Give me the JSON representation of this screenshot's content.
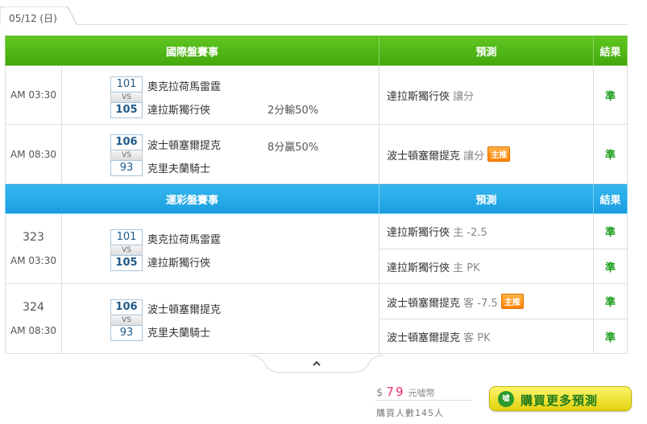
{
  "date_tab": "05/12 (日)",
  "intl_section": {
    "header": "國際盤賽事",
    "pred_header": "預測",
    "result_header": "結果",
    "games": [
      {
        "time": "AM 03:30",
        "away_num": "101",
        "away_name": "奧克拉荷馬雷霆",
        "vs": "VS",
        "home_num": "105",
        "home_name": "達拉斯獨行俠",
        "odds": "2分輸50%",
        "pred_team": "達拉斯獨行俠",
        "pred_type": "讓分",
        "badge": "",
        "result": "準"
      },
      {
        "time": "AM 08:30",
        "away_num": "106",
        "away_name": "波士頓塞爾提克",
        "vs": "VS",
        "home_num": "93",
        "home_name": "克里夫蘭騎士",
        "odds": "8分贏50%",
        "pred_team": "波士頓塞爾提克",
        "pred_type": "讓分",
        "badge": "主推",
        "result": "準"
      }
    ]
  },
  "sport_section": {
    "header": "運彩盤賽事",
    "pred_header": "預測",
    "result_header": "結果",
    "games": [
      {
        "num": "323",
        "time": "AM 03:30",
        "away_num": "101",
        "away_name": "奧克拉荷馬雷霆",
        "vs": "VS",
        "home_num": "105",
        "home_name": "達拉斯獨行俠",
        "preds": [
          {
            "team": "達拉斯獨行俠",
            "line": "主 -2.5",
            "badge": "",
            "result": "準"
          },
          {
            "team": "達拉斯獨行俠",
            "line": "主 PK",
            "badge": "",
            "result": "準"
          }
        ]
      },
      {
        "num": "324",
        "time": "AM 08:30",
        "away_num": "106",
        "away_name": "波士頓塞爾提克",
        "vs": "VS",
        "home_num": "93",
        "home_name": "克里夫蘭騎士",
        "preds": [
          {
            "team": "波士頓塞爾提克",
            "line": "客 -7.5",
            "badge": "主推",
            "result": "準"
          },
          {
            "team": "波士頓塞爾提克",
            "line": "客 PK",
            "badge": "",
            "result": "準"
          }
        ]
      }
    ]
  },
  "collapse_icon": "chevron-up-icon",
  "purchase": {
    "currency": "$",
    "amount": "79",
    "unit": "元噓幣",
    "buyers": "購買人數145人",
    "button_icon_text": "噓",
    "button_label": "購買更多預測"
  },
  "colors": {
    "green_header": "#4bb414",
    "blue_header": "#1fa6e6",
    "result_green": "#1a9c1a",
    "price_pink": "#ee2e6b",
    "badge_orange": "#ff8a00"
  }
}
